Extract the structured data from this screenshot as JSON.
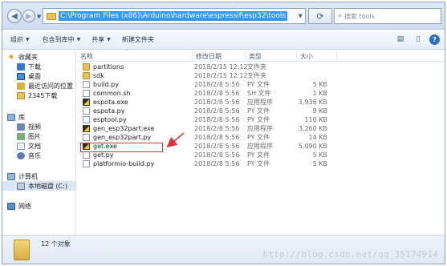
{
  "address_bar": {
    "path": "C:\\Program Files (x86)\\Arduino\\hardware\\espressif\\esp32\\tools",
    "search_placeholder": "搜索 tools"
  },
  "toolbar": {
    "organize": "组织",
    "include_in_library": "包含到库中",
    "share": "共享",
    "new_folder": "新建文件夹"
  },
  "nav": {
    "favorites": "收藏夹",
    "downloads": "下载",
    "desktop": "桌面",
    "recent_places": "最近访问的位置",
    "folder_2345": "2345下载",
    "libraries": "库",
    "videos": "视频",
    "pictures": "图片",
    "documents": "文档",
    "music": "音乐",
    "computer": "计算机",
    "local_disk": "本地磁盘 (C:)",
    "network": "网络"
  },
  "columns": {
    "name": "名称",
    "date": "修改日期",
    "type": "类型",
    "size": "大小"
  },
  "files": [
    {
      "name": "partitions",
      "date": "2018/2/15 12:12",
      "type": "文件夹",
      "size": "",
      "icon": "folder-icon"
    },
    {
      "name": "sdk",
      "date": "2018/2/15 12:12",
      "type": "文件夹",
      "size": "",
      "icon": "folder-icon"
    },
    {
      "name": "build.py",
      "date": "2018/2/8 5:56",
      "type": "PY 文件",
      "size": "5 KB",
      "icon": "python-file-icon"
    },
    {
      "name": "common.sh",
      "date": "2018/2/8 5:56",
      "type": "SH 文件",
      "size": "1 KB",
      "icon": "shell-file-icon"
    },
    {
      "name": "espota.exe",
      "date": "2018/2/8 5:56",
      "type": "应用程序",
      "size": "3,936 KB",
      "icon": "exe-file-icon"
    },
    {
      "name": "espota.py",
      "date": "2018/2/8 5:56",
      "type": "PY 文件",
      "size": "9 KB",
      "icon": "python-file-icon"
    },
    {
      "name": "esptool.py",
      "date": "2018/2/8 5:56",
      "type": "PY 文件",
      "size": "110 KB",
      "icon": "python-file-icon"
    },
    {
      "name": "gen_esp32part.exe",
      "date": "2018/2/8 5:56",
      "type": "应用程序",
      "size": "3,260 KB",
      "icon": "exe-file-icon"
    },
    {
      "name": "gen_esp32part.py",
      "date": "2018/2/8 5:56",
      "type": "PY 文件",
      "size": "14 KB",
      "icon": "python-file-icon"
    },
    {
      "name": "get.exe",
      "date": "2018/2/8 5:56",
      "type": "应用程序",
      "size": "5,090 KB",
      "icon": "exe-file-icon"
    },
    {
      "name": "get.py",
      "date": "2018/2/8 5:56",
      "type": "PY 文件",
      "size": "5 KB",
      "icon": "python-file-icon"
    },
    {
      "name": "platformio-build.py",
      "date": "2018/2/8 5:56",
      "type": "PY 文件",
      "size": "5 KB",
      "icon": "python-file-icon"
    }
  ],
  "status": {
    "item_count": "12 个对象"
  },
  "watermark": "http://blog.csdn.net/qq_35174914",
  "colors": {
    "highlight_box": "#e0303a",
    "annotation_arrow": "#e0303a",
    "selection": "#3399ff"
  }
}
